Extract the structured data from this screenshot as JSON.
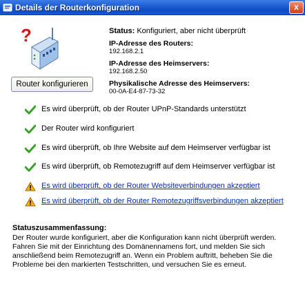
{
  "window": {
    "title": "Details der Routerkonfiguration",
    "close_label": "x"
  },
  "button": {
    "configure_label": "Router konfigurieren"
  },
  "status": {
    "label": "Status:",
    "value": "Konfiguriert, aber nicht überprüft"
  },
  "info": [
    {
      "label": "IP-Adresse des Routers:",
      "value": "192.168.2.1"
    },
    {
      "label": "IP-Adresse des Heimservers:",
      "value": "192.168.2.50"
    },
    {
      "label": "Physikalische Adresse des Heimservers:",
      "value": "00-0A-E4-87-73-32"
    }
  ],
  "checks": [
    {
      "state": "success",
      "icon": "check-icon",
      "text": "Es wird überprüft, ob der Router UPnP-Standards unterstützt"
    },
    {
      "state": "success",
      "icon": "check-icon",
      "text": "Der Router wird konfiguriert"
    },
    {
      "state": "success",
      "icon": "check-icon",
      "text": "Es wird überprüft, ob Ihre Website auf dem Heimserver verfügbar ist"
    },
    {
      "state": "success",
      "icon": "check-icon",
      "text": "Es wird überprüft, ob Remotezugriff auf dem Heimserver verfügbar ist"
    },
    {
      "state": "warning",
      "icon": "warning-icon",
      "text": "Es wird überprüft, ob der Router Websiteverbindungen akzeptiert"
    },
    {
      "state": "warning",
      "icon": "warning-icon",
      "text": "Es wird überprüft, ob der Router Remotezugriffsverbindungen akzeptiert"
    }
  ],
  "summary": {
    "title": "Statuszusammenfassung:",
    "text": "Der Router wurde konfiguriert, aber die Konfiguration kann nicht überprüft werden. Fahren Sie mit der Einrichtung des Domänennamens fort, und melden Sie sich anschließend beim Remotezugriff an. Wenn ein Problem auftritt, beheben Sie die Probleme bei den markierten Testschritten, und versuchen Sie es erneut."
  },
  "colors": {
    "titlebar": "#1c5cd3",
    "link": "#0b2ea8",
    "success": "#3aa02a",
    "warning": "#f2b01e"
  }
}
